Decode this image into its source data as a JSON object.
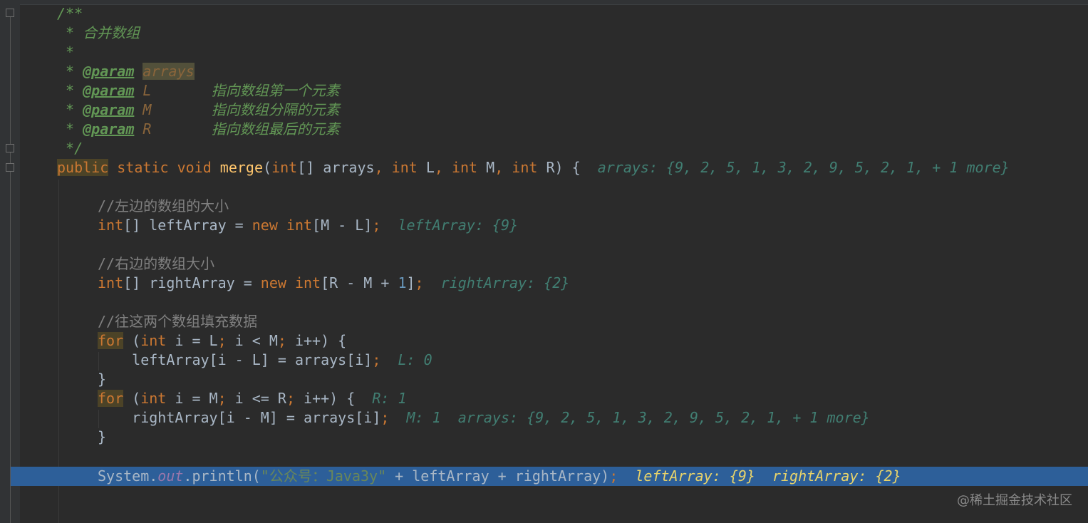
{
  "editor": {
    "doc": {
      "l1": "/**",
      "l2": " * 合并数组",
      "l3": " *",
      "star": " * ",
      "tag": "@param",
      "p_arrays": "arrays",
      "p_L": "L",
      "p_M": "M",
      "p_R": "R",
      "gap": "       ",
      "desc_L": "指向数组第一个元素",
      "desc_M": "指向数组分隔的元素",
      "desc_R": "指向数组最后的元素",
      "end": " */"
    },
    "signature": {
      "public": "public",
      "static_void": " static void ",
      "merge": "merge",
      "open": "(",
      "int1": "int",
      "rest1": "[] arrays",
      "comma1": ", ",
      "int2": "int",
      "rest2": " L",
      "comma2": ", ",
      "int3": "int",
      "rest3": " M",
      "comma3": ", ",
      "int4": "int",
      "rest4": " R) {  ",
      "hint": "arrays: {9, 2, 5, 1, 3, 2, 9, 5, 2, 1, + 1 more}"
    },
    "left": {
      "comment": "//左边的数组的大小",
      "int": "int",
      "mid": "[] leftArray = ",
      "new": "new",
      "sp": " ",
      "int2": "int",
      "tail": "[M - L]",
      "semi": ";",
      "hint": "  leftArray: {9}"
    },
    "right": {
      "comment": "//右边的数组大小",
      "int": "int",
      "mid": "[] rightArray = ",
      "new": "new",
      "sp": " ",
      "int2": "int",
      "a": "[R - M + ",
      "one": "1",
      "b": "]",
      "semi": ";",
      "hint": "  rightArray: {2}"
    },
    "fill_comment": "//往这两个数组填充数据",
    "for1": {
      "for": "for",
      "a": " (",
      "int": "int",
      "b": " i = L",
      "s1": ";",
      "c": " i < M",
      "s2": ";",
      "d": " i++) {",
      "body": "    leftArray[i - L] = arrays[i]",
      "semi": ";",
      "hint": "  L: 0",
      "close": "}"
    },
    "for2": {
      "for": "for",
      "a": " (",
      "int": "int",
      "b": " i = M",
      "s1": ";",
      "c": " i <= R",
      "s2": ";",
      "d": " i++) {  ",
      "hint1": "R: 1",
      "body": "    rightArray[i - M] = arrays[i]",
      "semi": ";",
      "hint2": "  M: 1  arrays: {9, 2, 5, 1, 3, 2, 9, 5, 2, 1, + 1 more}",
      "close": "}"
    },
    "println": {
      "system": "System.",
      "out": "out",
      "call": ".println(",
      "str": "\"公众号：Java3y\"",
      "rest": " + leftArray + rightArray)",
      "semi": ";",
      "hint": "  leftArray: {9}  rightArray: {2}"
    }
  },
  "watermark": "@稀土掘金技术社区",
  "colors": {
    "background": "#2b2b2b",
    "keyword": "#cc7832",
    "comment": "#808080",
    "doc_comment": "#629755",
    "number": "#6897bb",
    "string": "#6a8759",
    "execution_line": "#2d5f99"
  }
}
